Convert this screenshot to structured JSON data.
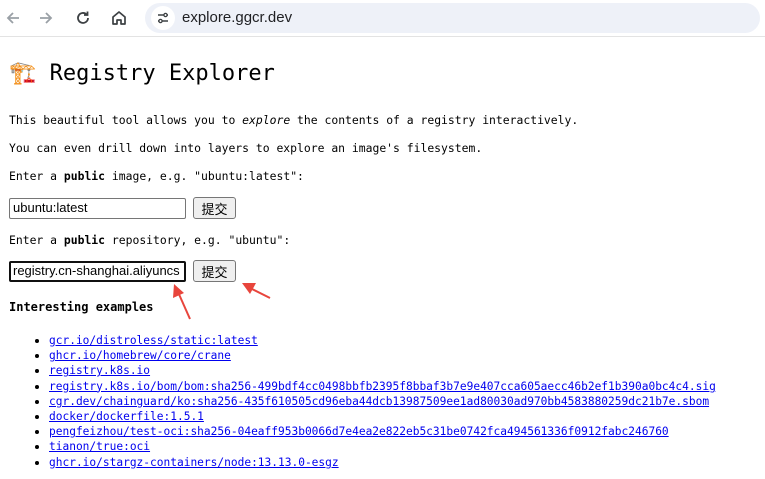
{
  "browser": {
    "url": "explore.ggcr.dev",
    "icons": [
      "back-arrow-icon",
      "forward-arrow-icon",
      "reload-icon",
      "home-icon",
      "site-info-icon"
    ]
  },
  "page": {
    "title_icon": "🏗️",
    "title": "Registry Explorer",
    "intro_pre": "This beautiful tool allows you to ",
    "intro_em": "explore",
    "intro_post": " the contents of a registry interactively.",
    "drill_text": "You can even drill down into layers to explore an image's filesystem.",
    "image_prompt_pre": "Enter a ",
    "image_prompt_bold": "public",
    "image_prompt_post": " image, e.g. \"ubuntu:latest\":",
    "image_value": "ubuntu:latest",
    "image_submit": "提交",
    "repo_prompt_pre": "Enter a ",
    "repo_prompt_bold": "public",
    "repo_prompt_post": " repository, e.g. \"ubuntu\":",
    "repo_value": "registry.cn-shanghai.aliyuncs",
    "repo_submit": "提交",
    "examples_title": "Interesting examples",
    "examples": [
      "gcr.io/distroless/static:latest",
      "ghcr.io/homebrew/core/crane",
      "registry.k8s.io",
      "registry.k8s.io/bom/bom:sha256-499bdf4cc0498bbfb2395f8bbaf3b7e9e407cca605aecc46b2ef1b390a0bc4c4.sig",
      "cgr.dev/chainguard/ko:sha256-435f610505cd96eba44dcb13987509ee1ad80030ad970bb4583880259dc21b7e.sbom",
      "docker/dockerfile:1.5.1",
      "pengfeizhou/test-oci:sha256-04eaff953b0066d7e4ea2e822eb5c31be0742fca494561336f0912fabc246760",
      "tianon/true:oci",
      "ghcr.io/stargz-containers/node:13.13.0-esgz"
    ]
  },
  "annotations": {
    "arrow_color": "#e8453c"
  }
}
